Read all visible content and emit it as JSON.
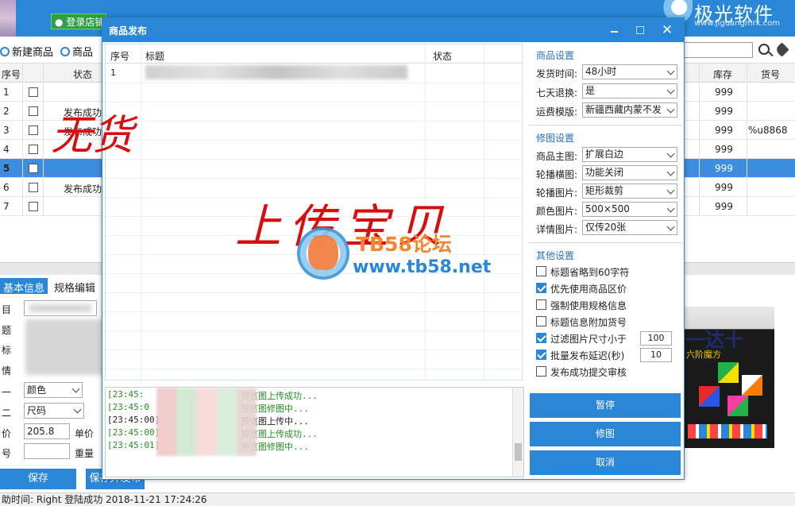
{
  "app": {
    "login_label": "登录店铺",
    "brand_name": "极光软件",
    "brand_url": "www.jiguangmrk.com"
  },
  "toolbar": {
    "new_product": "新建商品",
    "product_label": "商品"
  },
  "grid": {
    "headers": {
      "num": "序号",
      "status": "状态",
      "stock": "库存",
      "code": "货号"
    },
    "rows": [
      {
        "num": "1",
        "status": "",
        "stock": "999",
        "code": ""
      },
      {
        "num": "2",
        "status": "发布成功",
        "stock": "999",
        "code": ""
      },
      {
        "num": "3",
        "status": "发布成功",
        "stock": "999",
        "code": "%u8868"
      },
      {
        "num": "4",
        "status": "",
        "stock": "999",
        "code": ""
      },
      {
        "num": "5",
        "status": "",
        "stock": "999",
        "code": ""
      },
      {
        "num": "6",
        "status": "发布成功",
        "stock": "999",
        "code": ""
      },
      {
        "num": "7",
        "status": "",
        "stock": "999",
        "code": ""
      }
    ]
  },
  "lower": {
    "tab_basic": "基本信息",
    "tab_spec": "规格编辑",
    "labels": [
      "目",
      "题",
      "标",
      "情",
      "一",
      "二",
      "价",
      "号"
    ],
    "spec1_value": "颜色",
    "spec2_value": "尺码",
    "price_value": "205.8",
    "unit_price_label": "单价",
    "weight_label": "重量",
    "save_button": "保存",
    "save_publish_button": "保存并发布"
  },
  "product_image": {
    "title": "一达十",
    "subtitle": "六阶魔方"
  },
  "statusbar": {
    "text": "助时间: Right 登陆成功 2018-11-21 17:24:26"
  },
  "modal": {
    "title": "商品发布",
    "list_headers": {
      "num": "序号",
      "title": "标题",
      "status": "状态"
    },
    "list_row_num": "1",
    "log": [
      {
        "time": "[23:45:",
        "msg": "预览图上传成功...",
        "color": "green"
      },
      {
        "time": "[23:45:0",
        "msg": "预览图修图中...",
        "color": "green"
      },
      {
        "time": "[23:45:00]",
        "msg": "预览图上传中...",
        "color": "black"
      },
      {
        "time": "[23:45:00]",
        "msg": "预览图上传成功...",
        "color": "green"
      },
      {
        "time": "[23:45:01]",
        "msg": "预览图修图中...",
        "color": "green"
      }
    ],
    "product_settings": {
      "title": "商品设置",
      "rows": [
        {
          "label": "发货时间:",
          "value": "48小时"
        },
        {
          "label": "七天退换:",
          "value": "是"
        },
        {
          "label": "运费模版:",
          "value": "新疆西藏内蒙不发"
        }
      ]
    },
    "image_settings": {
      "title": "修图设置",
      "rows": [
        {
          "label": "商品主图:",
          "value": "扩展白边"
        },
        {
          "label": "轮播横图:",
          "value": "功能关闭"
        },
        {
          "label": "轮播图片:",
          "value": "矩形裁剪"
        },
        {
          "label": "颜色图片:",
          "value": "500×500"
        },
        {
          "label": "详情图片:",
          "value": "仅传20张"
        }
      ]
    },
    "other_settings": {
      "title": "其他设置",
      "options": [
        {
          "label": "标题省略到60字符",
          "checked": false
        },
        {
          "label": "优先使用商品区价",
          "checked": true
        },
        {
          "label": "强制使用规格信息",
          "checked": false
        },
        {
          "label": "标题信息附加货号",
          "checked": false
        },
        {
          "label": "过滤图片尺寸小于",
          "checked": true,
          "value": "100"
        },
        {
          "label": "批量发布延迟(秒)",
          "checked": true,
          "value": "10"
        },
        {
          "label": "发布成功提交审核",
          "checked": false
        }
      ]
    },
    "buttons": {
      "pause": "暂停",
      "retouch": "修图",
      "cancel": "取消"
    }
  },
  "overlay": {
    "hand_top": "无货",
    "hand_mid": "上传宝贝",
    "watermark_title": "TB58论坛",
    "watermark_url": "www.tb58.net"
  },
  "colors": {
    "accent": "#2a86d6",
    "success_green": "#1f8f1f",
    "annotation_red": "#d80d0d"
  }
}
